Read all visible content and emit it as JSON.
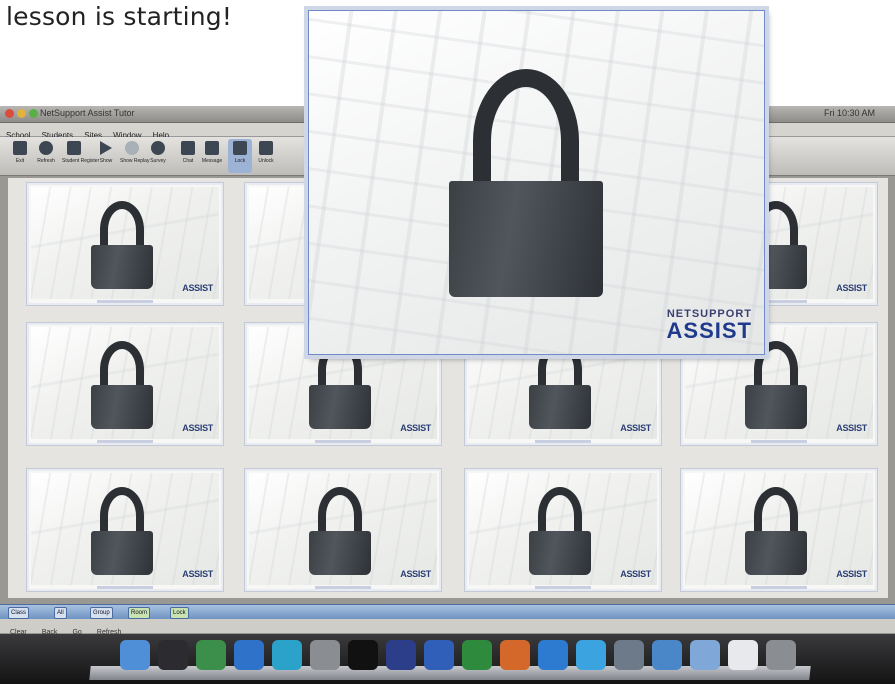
{
  "caption": "lesson is starting!",
  "window": {
    "title": "NetSupport Assist Tutor",
    "status_right": "Fri 10:30 AM",
    "menu": [
      "School",
      "Students",
      "Sites",
      "Window",
      "Help"
    ],
    "toolbar": [
      "Exit",
      "Refresh",
      "Student Register",
      "Show",
      "Show Replay",
      "Survey",
      "Chat",
      "Message",
      "Lock",
      "Unlock"
    ]
  },
  "thumbnails": {
    "brand": "ASSIST",
    "count": 12
  },
  "popup": {
    "brand_top": "NETSUPPORT",
    "brand_bottom": "ASSIST"
  },
  "statusbar": {
    "items": [
      "Class",
      "All",
      "Group",
      "Room",
      "Lock"
    ]
  },
  "infobar": {
    "items": [
      "Clear",
      "Back",
      "Go",
      "Refresh"
    ]
  },
  "dock": {
    "apps": [
      "finder-icon",
      "dashboard-icon",
      "activity-monitor-icon",
      "safari-icon",
      "time-machine-icon",
      "system-preferences-icon",
      "terminal-icon",
      "display-icon",
      "word-icon",
      "excel-icon",
      "powerpoint-icon",
      "outlook-icon",
      "messenger-icon",
      "app-icon",
      "netsupport-icon",
      "folder-icon",
      "documents-icon",
      "trash-icon"
    ]
  },
  "colors": {
    "accent": "#6f8cc8",
    "lock_body": "#474c51",
    "brand": "#1f3a8c"
  }
}
